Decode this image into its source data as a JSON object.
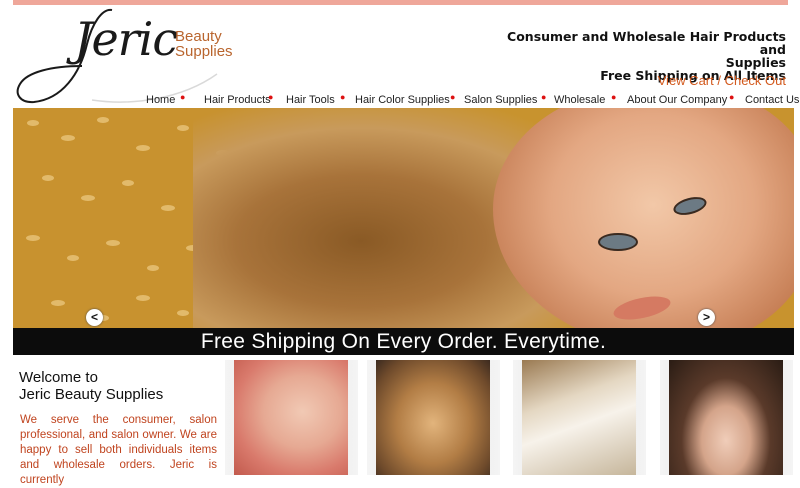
{
  "brand": {
    "name": "Jeric",
    "sub_line1": "Beauty",
    "sub_line2": "Supplies"
  },
  "header": {
    "tagline_line1": "Consumer and Wholesale Hair Products and",
    "tagline_line2": "Supplies",
    "tagline_line3": "Free Shipping on All Items",
    "cart_label": "View Cart / Check Out"
  },
  "nav": [
    "Home",
    "Hair Products",
    "Hair Tools",
    "Hair  Color Supplies",
    "Salon Supplies",
    "Wholesale",
    "About Our Company",
    "Contact Us"
  ],
  "hero": {
    "banner": "Free Shipping On Every Order. Everytime.",
    "prev": "<",
    "next": ">"
  },
  "welcome": {
    "title_line1": "Welcome to",
    "title_line2": "Jeric Beauty Supplies",
    "body": "We serve the consumer, salon professional, and salon owner. We are happy to sell both individuals items and wholesale orders. Jeric is currently"
  },
  "colors": {
    "accent": "#d35a1e",
    "topbar": "#efa79a",
    "nav_dot": "#dd1111",
    "welcome_text": "#c0441f"
  }
}
